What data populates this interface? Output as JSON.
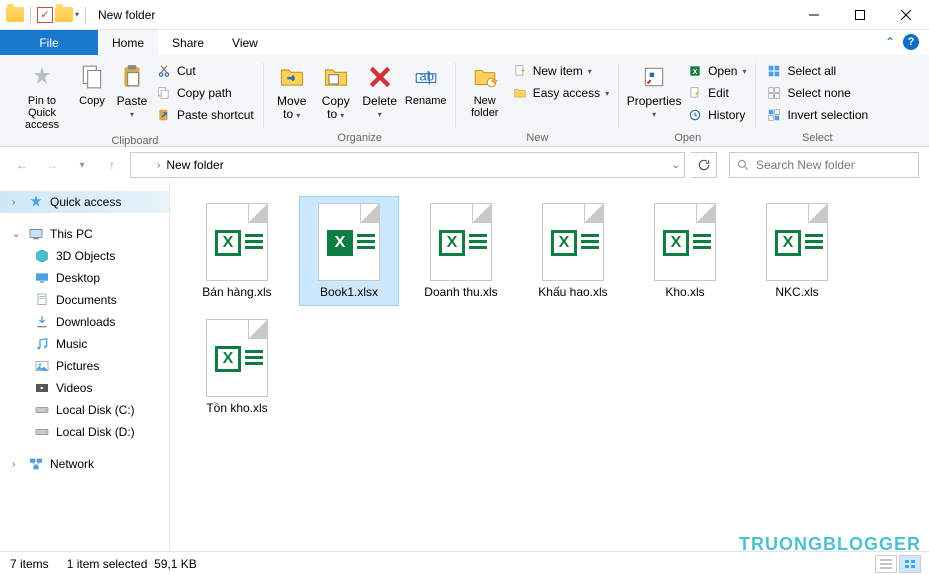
{
  "title": "New folder",
  "tabs": {
    "file": "File",
    "home": "Home",
    "share": "Share",
    "view": "View"
  },
  "ribbon": {
    "clipboard": {
      "label": "Clipboard",
      "pin": "Pin to Quick access",
      "copy": "Copy",
      "paste": "Paste",
      "cut": "Cut",
      "copypath": "Copy path",
      "shortcut": "Paste shortcut"
    },
    "organize": {
      "label": "Organize",
      "moveto": "Move to",
      "copyto": "Copy to",
      "delete": "Delete",
      "rename": "Rename"
    },
    "new": {
      "label": "New",
      "newfolder": "New folder",
      "newitem": "New item",
      "easyaccess": "Easy access"
    },
    "open": {
      "label": "Open",
      "properties": "Properties",
      "open": "Open",
      "edit": "Edit",
      "history": "History"
    },
    "select": {
      "label": "Select",
      "all": "Select all",
      "none": "Select none",
      "invert": "Invert selection"
    }
  },
  "breadcrumb": {
    "loc": "New folder"
  },
  "search": {
    "placeholder": "Search New folder"
  },
  "tree": {
    "quick": "Quick access",
    "pc": "This PC",
    "items": [
      "3D Objects",
      "Desktop",
      "Documents",
      "Downloads",
      "Music",
      "Pictures",
      "Videos",
      "Local Disk (C:)",
      "Local Disk (D:)"
    ],
    "network": "Network"
  },
  "files": [
    {
      "name": "Bán hàng.xls",
      "sel": false
    },
    {
      "name": "Book1.xlsx",
      "sel": true
    },
    {
      "name": "Doanh thu.xls",
      "sel": false
    },
    {
      "name": "Khấu hao.xls",
      "sel": false
    },
    {
      "name": "Kho.xls",
      "sel": false
    },
    {
      "name": "NKC.xls",
      "sel": false
    },
    {
      "name": "Tồn kho.xls",
      "sel": false
    }
  ],
  "status": {
    "count": "7 items",
    "sel": "1 item selected",
    "size": "59,1 KB"
  },
  "watermark": "TRUONGBLOGGER"
}
